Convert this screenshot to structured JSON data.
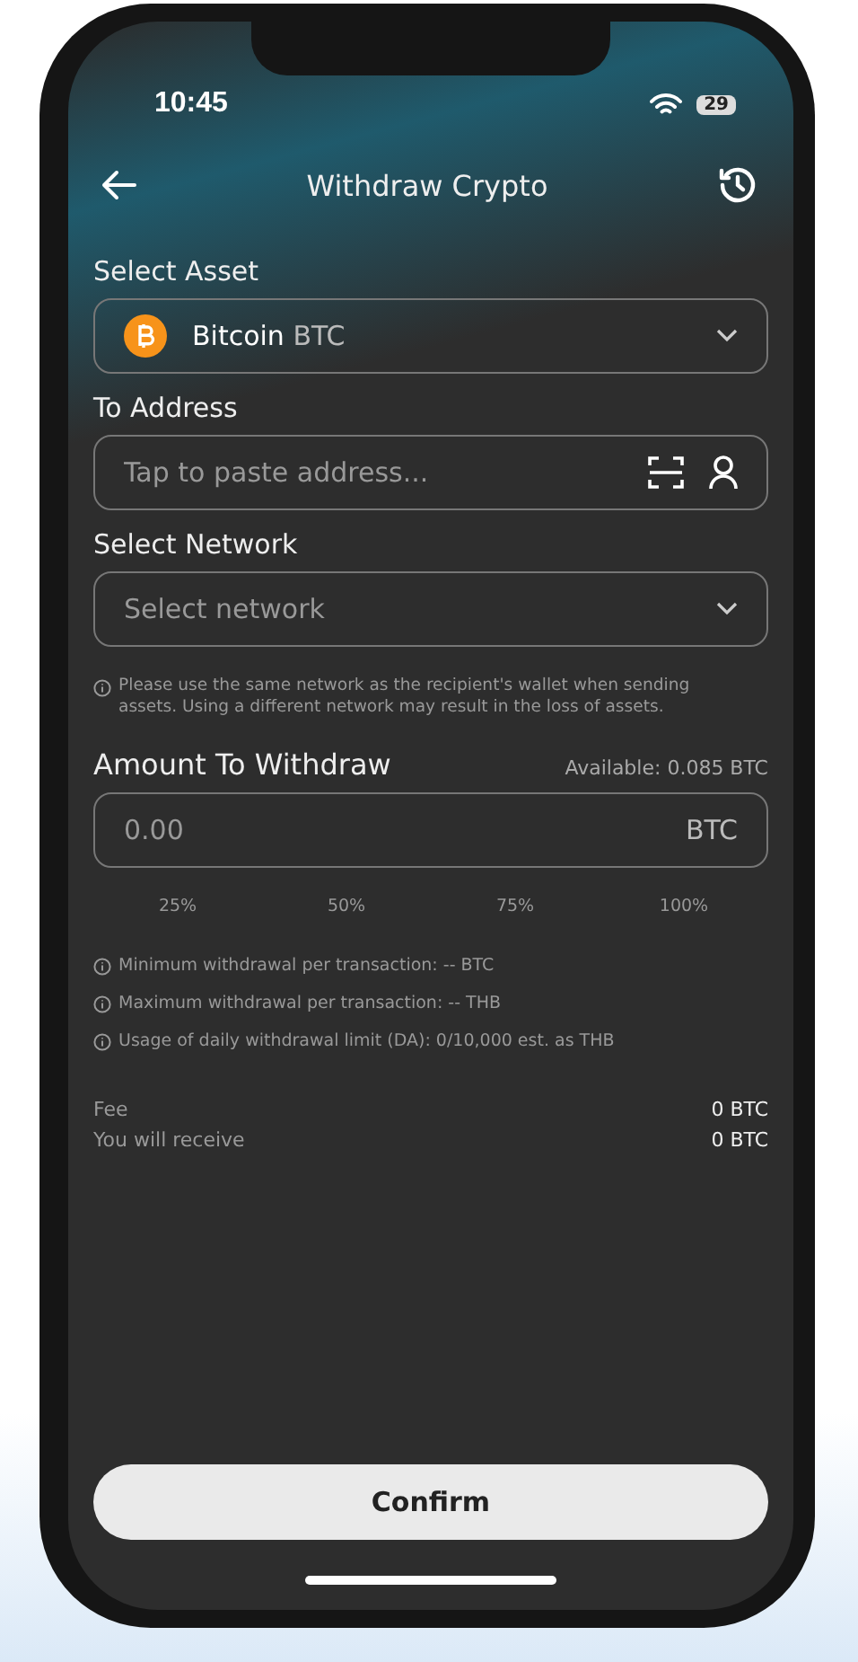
{
  "status_bar": {
    "time": "10:45",
    "battery": "29"
  },
  "header": {
    "title": "Withdraw Crypto"
  },
  "asset": {
    "label": "Select Asset",
    "name": "Bitcoin",
    "symbol": "BTC"
  },
  "address": {
    "label": "To Address",
    "placeholder": "Tap to paste address..."
  },
  "network": {
    "label": "Select Network",
    "placeholder": "Select network",
    "note": "Please use the same network as the recipient's wallet when sending assets. Using a different network may result in the loss of assets."
  },
  "amount": {
    "label": "Amount To Withdraw",
    "available": "Available: 0.085 BTC",
    "placeholder": "0.00",
    "unit": "BTC"
  },
  "percent_options": [
    "25%",
    "50%",
    "75%",
    "100%"
  ],
  "limits": [
    "Minimum withdrawal per transaction:  -- BTC",
    "Maximum withdrawal per transaction: -- THB",
    "Usage of daily withdrawal limit (DA): 0/10,000 est. as THB"
  ],
  "summary": [
    {
      "label": "Fee",
      "value": "0 BTC"
    },
    {
      "label": "You will receive",
      "value": "0 BTC"
    }
  ],
  "confirm_button": "Confirm"
}
